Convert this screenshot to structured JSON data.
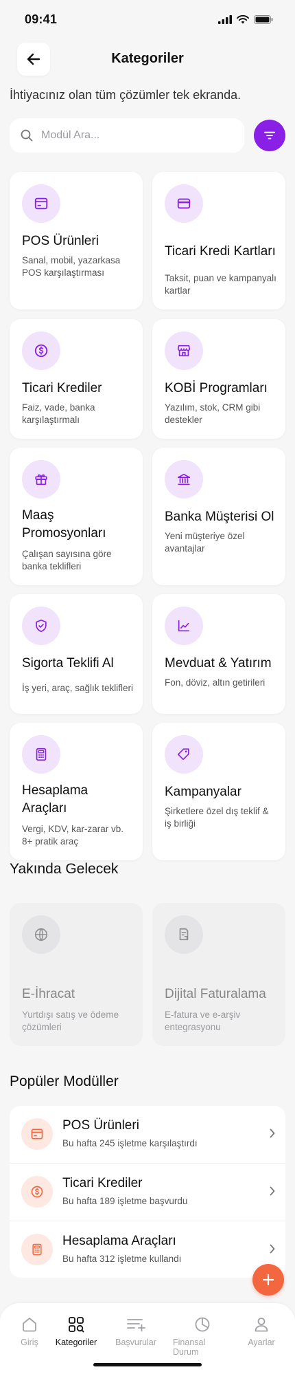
{
  "status_bar": {
    "time": "09:41"
  },
  "header": {
    "title": "Kategoriler"
  },
  "subtitle": "İhtiyacınız olan tüm çözümler tek ekranda.",
  "search": {
    "placeholder": "Modül Ara...",
    "value": ""
  },
  "categories": [
    {
      "title": "POS Ürünleri",
      "desc": "Sanal, mobil, yazarkasa POS karşılaştırması",
      "icon": "pos-terminal-icon"
    },
    {
      "title": "Ticari Kredi Kartları",
      "desc": "Taksit, puan ve kampanyalı kartlar",
      "icon": "credit-card-icon"
    },
    {
      "title": "Ticari Krediler",
      "desc": "Faiz, vade, banka karşılaştırmalı",
      "icon": "dollar-coin-icon"
    },
    {
      "title": "KOBİ Programları",
      "desc": "Yazılım, stok, CRM gibi destekler",
      "icon": "storefront-icon"
    },
    {
      "title": "Maaş Promosyonları",
      "desc": "Çalışan sayısına göre banka teklifleri",
      "icon": "gift-icon"
    },
    {
      "title": "Banka Müşterisi Ol",
      "desc": "Yeni müşteriye özel avantajlar",
      "icon": "bank-icon"
    },
    {
      "title": "Sigorta Teklifi Al",
      "desc": "İş yeri, araç, sağlık teklifleri",
      "icon": "shield-check-icon"
    },
    {
      "title": "Mevduat & Yatırım",
      "desc": "Fon, döviz, altın getirileri",
      "icon": "chart-line-icon"
    },
    {
      "title": "Hesaplama Araçları",
      "desc": "Vergi, KDV, kar-zarar vb. 8+ pratik araç",
      "icon": "calculator-icon"
    },
    {
      "title": "Kampanyalar",
      "desc": "Şirketlere özel dış teklif & iş birliği",
      "icon": "tag-icon"
    }
  ],
  "coming_soon": {
    "title": "Yakında Gelecek",
    "items": [
      {
        "title": "E-İhracat",
        "desc": "Yurtdışı satış ve ödeme çözümleri",
        "icon": "globe-icon"
      },
      {
        "title": "Dijital Faturalama",
        "desc": "E-fatura ve e-arşiv entegrasyonu",
        "icon": "invoice-icon"
      }
    ]
  },
  "popular": {
    "title": "Popüler Modüller",
    "items": [
      {
        "title": "POS Ürünleri",
        "sub": "Bu hafta 245 işletme karşılaştırdı",
        "icon": "pos-terminal-icon"
      },
      {
        "title": "Ticari Krediler",
        "sub": "Bu hafta 189 işletme başvurdu",
        "icon": "dollar-coin-icon"
      },
      {
        "title": "Hesaplama Araçları",
        "sub": "Bu hafta 312 işletme kullandı",
        "icon": "calculator-icon"
      }
    ]
  },
  "tabs": [
    {
      "label": "Giriş",
      "icon": "home-icon",
      "active": false
    },
    {
      "label": "Kategoriler",
      "icon": "category-search-icon",
      "active": true
    },
    {
      "label": "Başvurular",
      "icon": "list-add-icon",
      "active": false
    },
    {
      "label": "Finansal Durum",
      "icon": "pie-chart-icon",
      "active": false
    },
    {
      "label": "Ayarlar",
      "icon": "user-icon",
      "active": false
    }
  ],
  "colors": {
    "accent": "#8a1fe6",
    "accent_soft": "#f1e3fb",
    "fab": "#f2673f",
    "popular_icon_bg": "#fde8e2"
  }
}
